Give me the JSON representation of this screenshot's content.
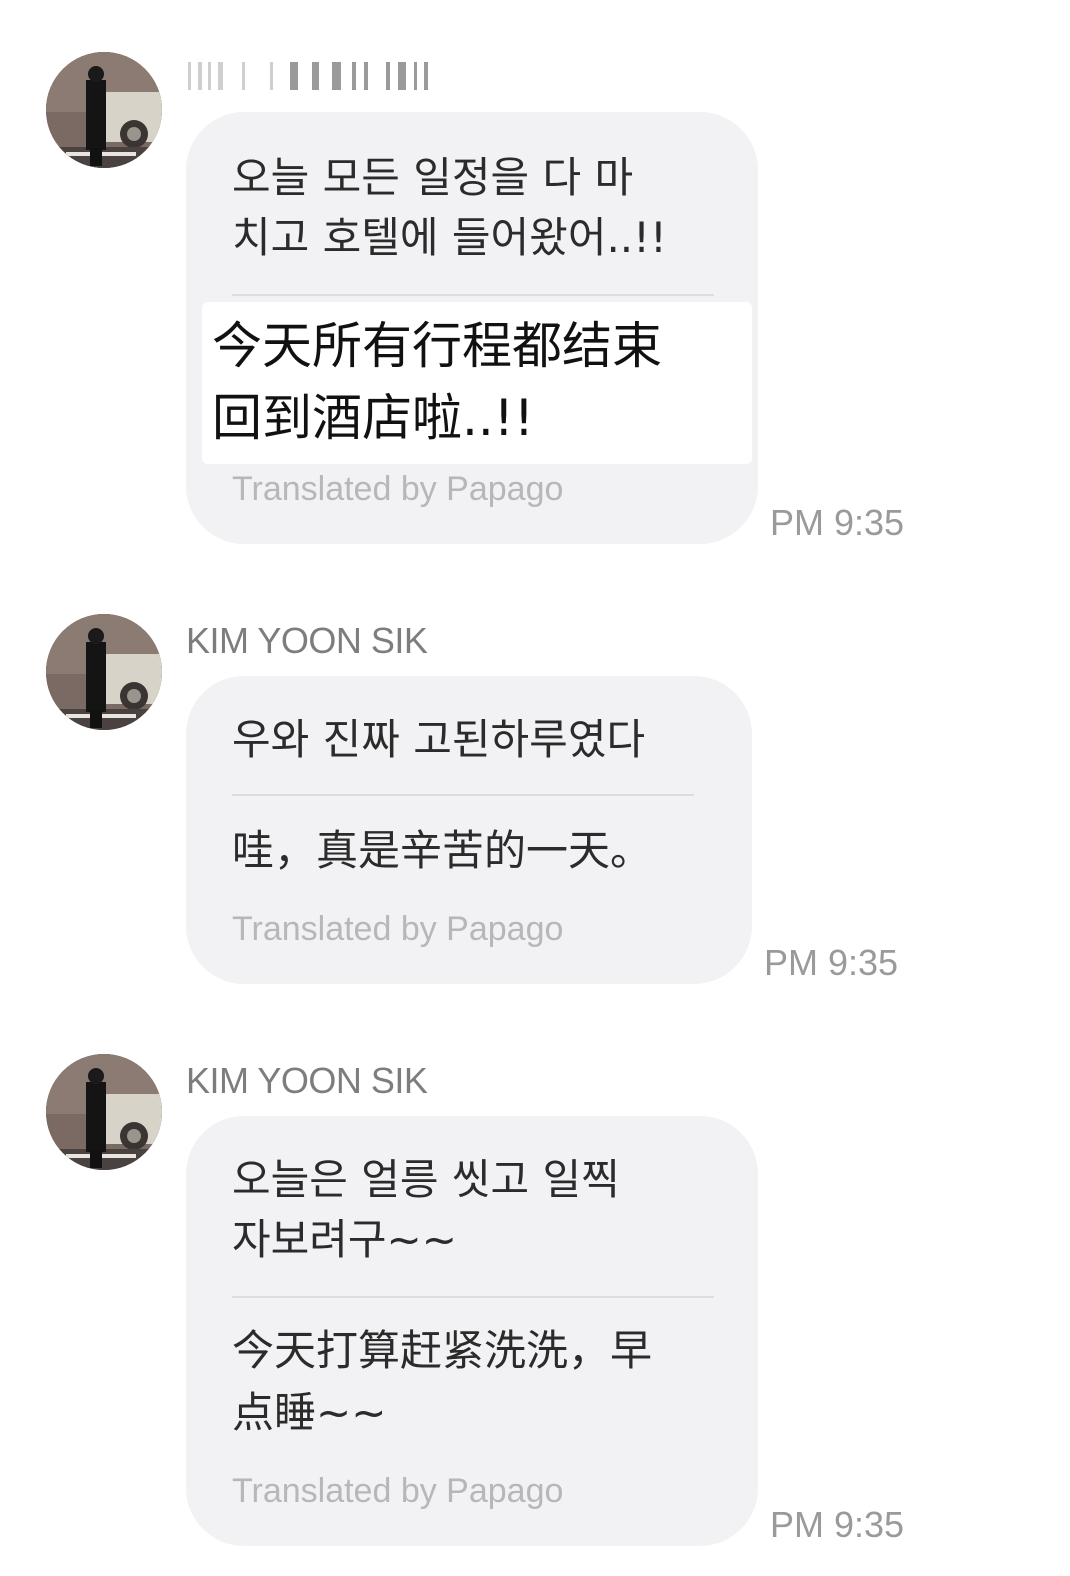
{
  "messages": [
    {
      "sender": "",
      "korean": [
        "오늘 모든 일정을 다 마",
        "치고 호텔에 들어왔어..!!"
      ],
      "chinese": [
        "今天所有行程都结束",
        "回到酒店啦..!!"
      ],
      "chinese_highlighted": true,
      "translator": "Translated by Papago",
      "time": "PM 9:35"
    },
    {
      "sender": "KIM YOON SIK",
      "korean": [
        "우와 진짜 고된하루였다"
      ],
      "chinese": [
        "哇，真是辛苦的一天。"
      ],
      "chinese_highlighted": false,
      "translator": "Translated by Papago",
      "time": "PM 9:35"
    },
    {
      "sender": "KIM YOON SIK",
      "korean": [
        "오늘은 얼릉 씻고 일찍",
        "자보려구~~"
      ],
      "chinese": [
        "今天打算赶紧洗洗，早",
        "点睡~~"
      ],
      "chinese_highlighted": false,
      "translator": "Translated by Papago",
      "time": "PM 9:35"
    }
  ],
  "colors": {
    "bubble": "#f2f2f4",
    "sender": "#7d7d7d",
    "time": "#9a9a9d",
    "translator": "#b7b7ba"
  },
  "icons": {
    "avatar": "user-photo-avatar"
  }
}
